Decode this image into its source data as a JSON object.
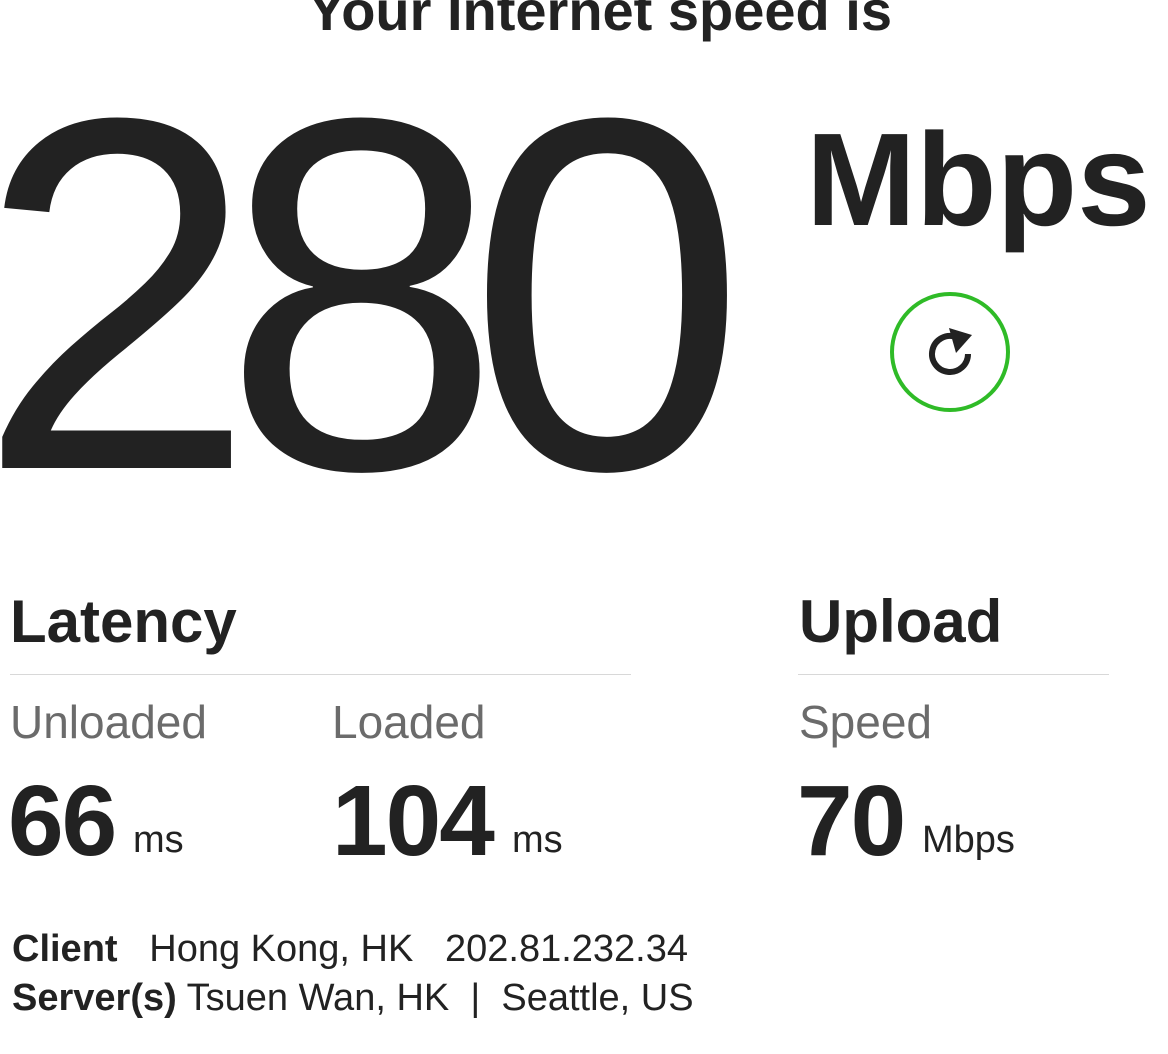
{
  "headline": "Your Internet speed is",
  "download": {
    "value": "280",
    "unit": "Mbps"
  },
  "latency": {
    "title": "Latency",
    "unloaded": {
      "label": "Unloaded",
      "value": "66",
      "unit": "ms"
    },
    "loaded": {
      "label": "Loaded",
      "value": "104",
      "unit": "ms"
    }
  },
  "upload": {
    "title": "Upload",
    "speed": {
      "label": "Speed",
      "value": "70",
      "unit": "Mbps"
    }
  },
  "info": {
    "client_label": "Client",
    "client_location": "Hong Kong, HK",
    "client_ip": "202.81.232.34",
    "server_label": "Server(s)",
    "server_primary": "Tsuen Wan, HK",
    "separator": "|",
    "server_secondary": "Seattle, US"
  },
  "icons": {
    "refresh": "refresh-icon"
  },
  "colors": {
    "accent": "#2fbb27",
    "text": "#222222",
    "muted": "#6b6b6b"
  }
}
